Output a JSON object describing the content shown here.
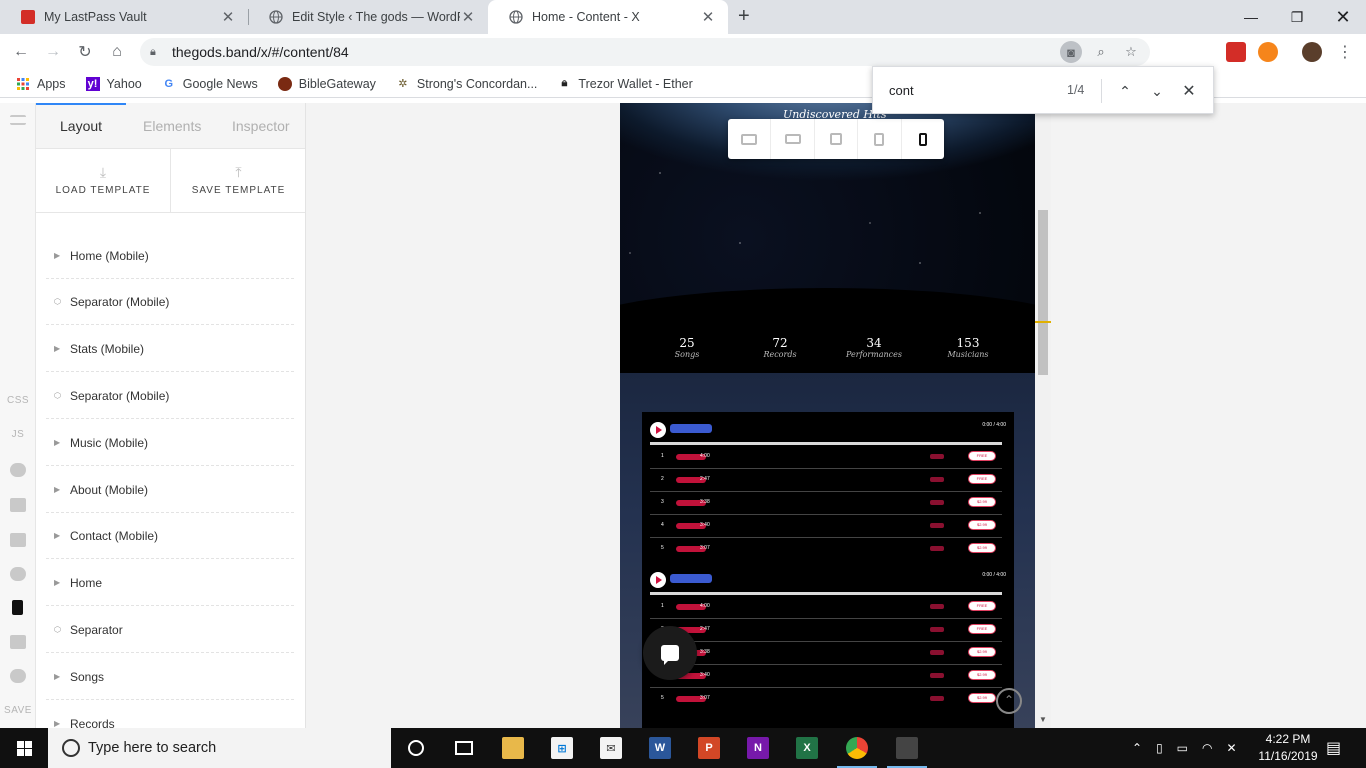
{
  "browser": {
    "tabs": [
      {
        "title": "My LastPass Vault",
        "icon": "lastpass-icon",
        "active": false
      },
      {
        "title": "Edit Style ‹ The gods — WordPre",
        "icon": "globe-icon",
        "active": false
      },
      {
        "title": "Home - Content - X",
        "icon": "globe-icon",
        "active": true
      }
    ],
    "new_tab_label": "+",
    "address": "thegods.band/x/#/content/84",
    "bookmarks": [
      {
        "label": "Apps",
        "icon": "apps-grid-icon"
      },
      {
        "label": "Yahoo",
        "icon": "yahoo-icon"
      },
      {
        "label": "Google News",
        "icon": "google-icon"
      },
      {
        "label": "BibleGateway",
        "icon": "biblegateway-icon"
      },
      {
        "label": "Strong's Concordan...",
        "icon": "strongs-icon"
      },
      {
        "label": "Trezor Wallet - Ether",
        "icon": "lock-icon"
      }
    ],
    "find": {
      "query": "cont",
      "count": "1/4"
    }
  },
  "builder": {
    "panel_tabs": [
      "Layout",
      "Elements",
      "Inspector"
    ],
    "load_template": "LOAD TEMPLATE",
    "save_template": "SAVE TEMPLATE",
    "tree": [
      {
        "label": "Home (Mobile)",
        "type": "section"
      },
      {
        "label": "Separator (Mobile)",
        "type": "separator"
      },
      {
        "label": "Stats (Mobile)",
        "type": "section"
      },
      {
        "label": "Separator (Mobile)",
        "type": "separator"
      },
      {
        "label": "Music (Mobile)",
        "type": "section"
      },
      {
        "label": "About (Mobile)",
        "type": "section"
      },
      {
        "label": "Contact (Mobile)",
        "type": "section"
      },
      {
        "label": "Home",
        "type": "section"
      },
      {
        "label": "Separator",
        "type": "separator"
      },
      {
        "label": "Songs",
        "type": "section"
      },
      {
        "label": "Records",
        "type": "section"
      }
    ],
    "rail": {
      "css": "CSS",
      "js": "JS",
      "save": "SAVE"
    }
  },
  "site": {
    "hero_title": "Undiscovered Hits",
    "stats": [
      {
        "value": "25",
        "label": "Songs"
      },
      {
        "value": "72",
        "label": "Records"
      },
      {
        "value": "34",
        "label": "Performances"
      },
      {
        "value": "153",
        "label": "Musicians"
      }
    ],
    "player_time": "0:00 / 4:00",
    "tracks": [
      {
        "n": "1",
        "dur": "4:00",
        "buy": "FREE"
      },
      {
        "n": "2",
        "dur": "2:47",
        "buy": "FREE"
      },
      {
        "n": "3",
        "dur": "3:38",
        "buy": "$2.99"
      },
      {
        "n": "4",
        "dur": "3:40",
        "buy": "$2.99"
      },
      {
        "n": "5",
        "dur": "3:07",
        "buy": "$2.99"
      }
    ]
  },
  "taskbar": {
    "search_placeholder": "Type here to search",
    "time": "4:22 PM",
    "date": "11/16/2019"
  },
  "colors": {
    "accent_blue": "#2f86f6",
    "player_red": "#d1103f",
    "site_bg": "#050810"
  }
}
